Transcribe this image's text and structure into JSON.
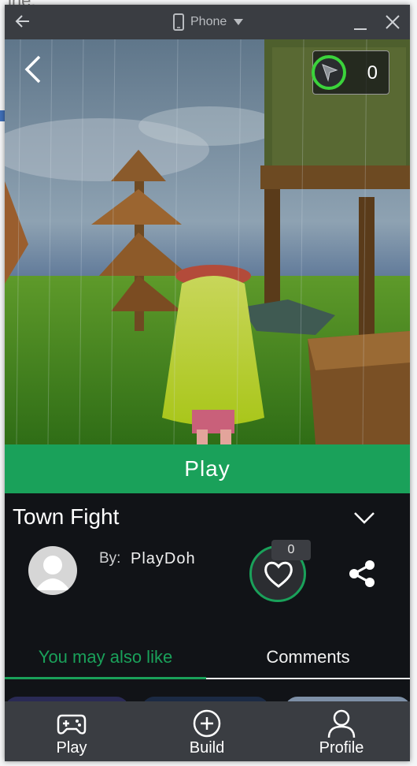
{
  "window": {
    "device_label": "Phone"
  },
  "game": {
    "title": "Town Fight",
    "play_label": "Play",
    "author_prefix": "By:",
    "author": "PlayDoh",
    "likes": "0"
  },
  "currency": {
    "amount": "0"
  },
  "tabs": [
    {
      "label": "You may also like",
      "active": true
    },
    {
      "label": "Comments",
      "active": false
    }
  ],
  "bottom_nav": [
    {
      "label": "Play",
      "icon": "gamepad-icon"
    },
    {
      "label": "Build",
      "icon": "plus-circle-icon"
    },
    {
      "label": "Profile",
      "icon": "user-icon"
    }
  ],
  "colors": {
    "accent": "#1aa15a",
    "background": "#111317",
    "bar": "#3a3d42"
  }
}
